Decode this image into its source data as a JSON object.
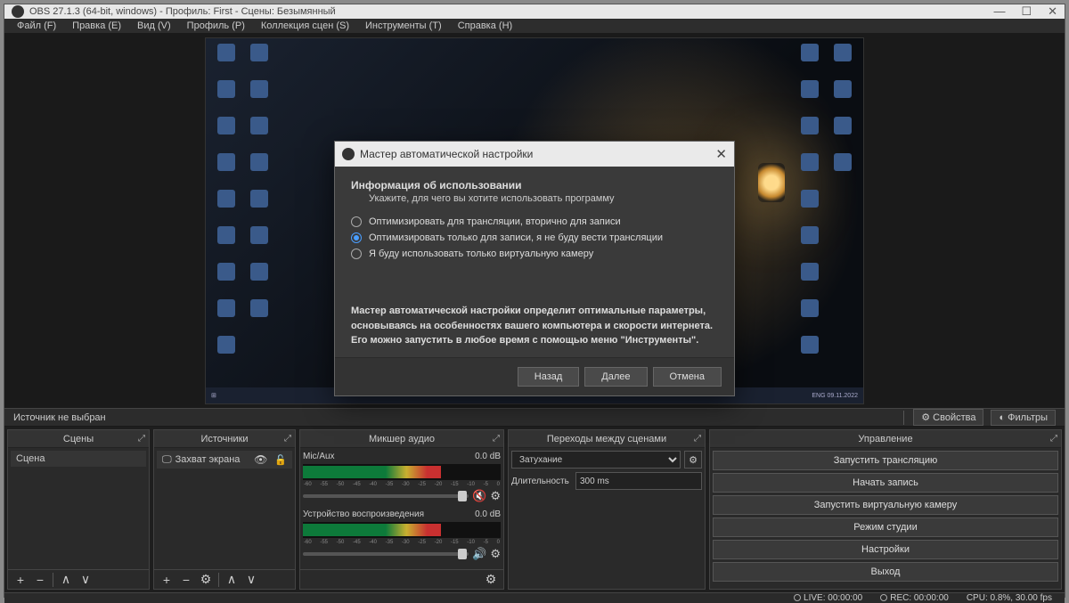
{
  "titlebar": {
    "text": "OBS 27.1.3 (64-bit, windows) - Профиль: First - Сцены: Безымянный"
  },
  "menu": [
    "Файл (F)",
    "Правка (E)",
    "Вид (V)",
    "Профиль (P)",
    "Коллекция сцен (S)",
    "Инструменты (T)",
    "Справка (H)"
  ],
  "source_bar": {
    "label": "Источник не выбран",
    "properties": "Свойства",
    "filters": "Фильтры"
  },
  "docks": {
    "scenes": {
      "title": "Сцены",
      "items": [
        "Сцена"
      ]
    },
    "sources": {
      "title": "Источники",
      "items": [
        "Захват экрана"
      ]
    },
    "mixer": {
      "title": "Микшер аудио",
      "channels": [
        {
          "name": "Mic/Aux",
          "db": "0.0 dB",
          "muted": true
        },
        {
          "name": "Устройство воспроизведения",
          "db": "0.0 dB",
          "muted": false
        }
      ],
      "ticks": [
        "-60",
        "-55",
        "-50",
        "-45",
        "-40",
        "-35",
        "-30",
        "-25",
        "-20",
        "-15",
        "-10",
        "-5",
        "0"
      ]
    },
    "transitions": {
      "title": "Переходы между сценами",
      "type": "Затухание",
      "dur_label": "Длительность",
      "dur_value": "300 ms"
    },
    "controls": {
      "title": "Управление",
      "buttons": [
        "Запустить трансляцию",
        "Начать запись",
        "Запустить виртуальную камеру",
        "Режим студии",
        "Настройки",
        "Выход"
      ]
    }
  },
  "status": {
    "live": "LIVE: 00:00:00",
    "rec": "REC: 00:00:00",
    "cpu": "CPU: 0.8%, 30.00 fps"
  },
  "wizard": {
    "title": "Мастер автоматической настройки",
    "heading": "Информация об использовании",
    "subtitle": "Укажите, для чего вы хотите использовать программу",
    "options": [
      "Оптимизировать для трансляции, вторично для записи",
      "Оптимизировать только для записи, я не буду вести трансляции",
      "Я буду использовать только виртуальную камеру"
    ],
    "selected": 1,
    "info1": "Мастер автоматической настройки определит оптимальные параметры, основываясь на особенностях вашего компьютера и скорости интернета.",
    "info2": "Его можно запустить в любое время с помощью меню \"Инструменты\".",
    "buttons": {
      "back": "Назад",
      "next": "Далее",
      "cancel": "Отмена"
    }
  }
}
